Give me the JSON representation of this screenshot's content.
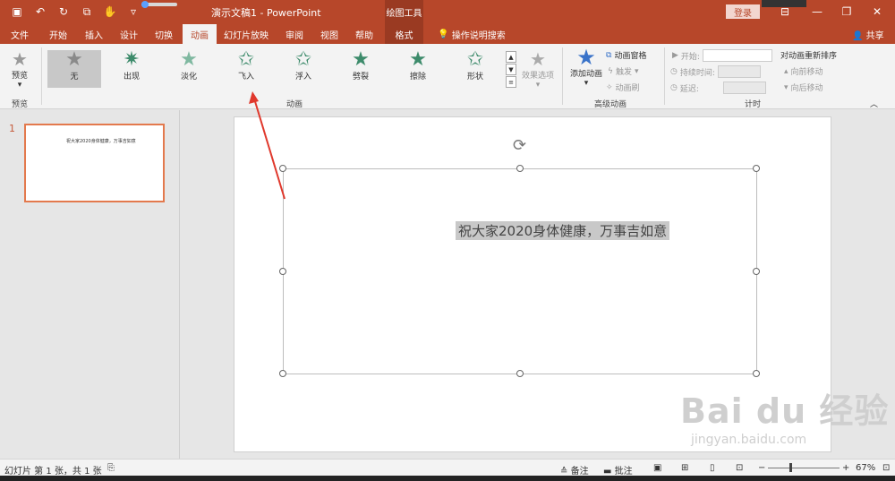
{
  "titlebar": {
    "doc_title": "演示文稿1  -  PowerPoint",
    "tool_context": "绘图工具",
    "login": "登录"
  },
  "tabs": [
    "文件",
    "开始",
    "插入",
    "设计",
    "切换",
    "动画",
    "幻灯片放映",
    "审阅",
    "视图",
    "帮助",
    "格式"
  ],
  "active_tab": "动画",
  "search_hint": "操作说明搜索",
  "share": "共享",
  "ribbon": {
    "preview": {
      "label": "预览",
      "group": "预览"
    },
    "animations": {
      "items": [
        "无",
        "出现",
        "淡化",
        "飞入",
        "浮入",
        "劈裂",
        "擦除",
        "形状"
      ],
      "selected": "无",
      "group": "动画",
      "effect_options": "效果选项"
    },
    "advanced": {
      "add_animation": "添加动画",
      "pane": "动画窗格",
      "trigger": "触发",
      "painter": "动画刷",
      "group": "高级动画"
    },
    "timing": {
      "start": "开始:",
      "duration": "持续时间:",
      "delay": "延迟:",
      "reorder": "对动画重新排序",
      "move_earlier": "向前移动",
      "move_later": "向后移动",
      "group": "计时"
    }
  },
  "thumbnail": {
    "number": "1",
    "text": "祝大家2020身体健康，万事吉如意"
  },
  "slide": {
    "text": "祝大家2020身体健康，万事吉如意"
  },
  "status": {
    "slide_info": "幻灯片 第 1 张，共 1 张",
    "notes": "备注",
    "comments": "批注",
    "zoom": "67%"
  },
  "watermark": {
    "main": "Bai du 经验",
    "sub": "jingyan.baidu.com"
  }
}
